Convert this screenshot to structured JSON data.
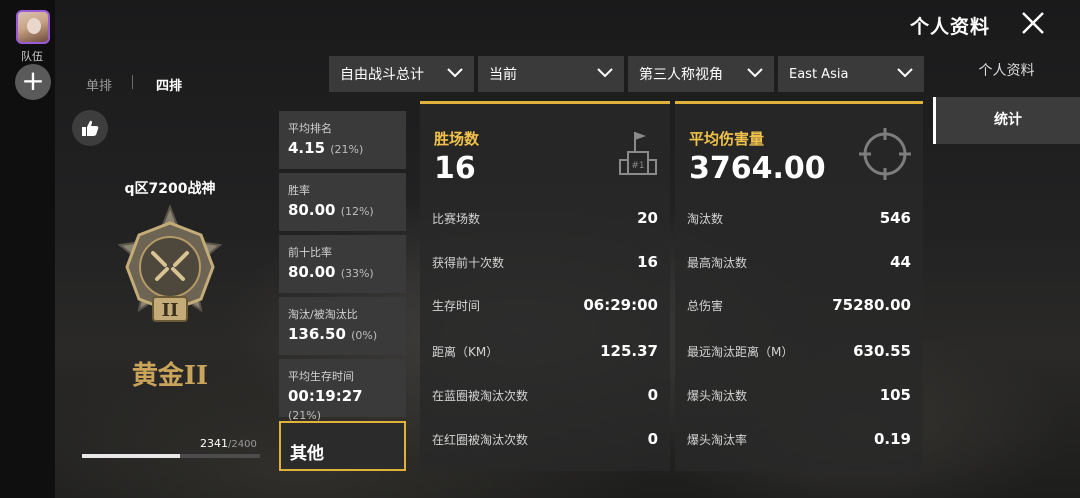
{
  "sidebar": {
    "team_label": "队伍",
    "add_label": "+"
  },
  "header": {
    "title": "个人资料"
  },
  "modes": {
    "solo": "单排",
    "squad": "四排",
    "active": "squad"
  },
  "player": {
    "name": "q区7200战神",
    "rank_name": "黄金II",
    "rank_points": "2341",
    "rank_points_max": "/2400",
    "rank_progress": 0.55
  },
  "filters": [
    {
      "label": "自由战斗总计"
    },
    {
      "label": "当前"
    },
    {
      "label": "第三人称视角"
    },
    {
      "label": "East Asia"
    }
  ],
  "summary_cards": [
    {
      "label": "平均排名",
      "value": "4.15",
      "pct": "(21%)"
    },
    {
      "label": "胜率",
      "value": "80.00",
      "pct": "(12%)"
    },
    {
      "label": "前十比率",
      "value": "80.00",
      "pct": "(33%)"
    },
    {
      "label": "淘汰/被淘汰比",
      "value": "136.50",
      "pct": "(0%)"
    },
    {
      "label": "平均生存时间",
      "value": "00:19:27",
      "pct": "(21%)"
    }
  ],
  "other_card": {
    "label": "其他"
  },
  "wins_panel": {
    "title": "胜场数",
    "value": "16",
    "rows": [
      {
        "label": "比赛场数",
        "value": "20"
      },
      {
        "label": "获得前十次数",
        "value": "16"
      },
      {
        "label": "生存时间",
        "value": "06:29:00"
      },
      {
        "label": "距离（KM）",
        "value": "125.37"
      },
      {
        "label": "在蓝圈被淘汰次数",
        "value": "0"
      },
      {
        "label": "在红圈被淘汰次数",
        "value": "0"
      }
    ]
  },
  "damage_panel": {
    "title": "平均伤害量",
    "value": "3764.00",
    "rows": [
      {
        "label": "淘汰数",
        "value": "546"
      },
      {
        "label": "最高淘汰数",
        "value": "44"
      },
      {
        "label": "总伤害",
        "value": "75280.00"
      },
      {
        "label": "最远淘汰距离（M）",
        "value": "630.55"
      },
      {
        "label": "爆头淘汰数",
        "value": "105"
      },
      {
        "label": "爆头淘汰率",
        "value": "0.19"
      }
    ]
  },
  "side_nav": [
    {
      "label": "个人资料",
      "active": false
    },
    {
      "label": "统计",
      "active": true
    }
  ]
}
